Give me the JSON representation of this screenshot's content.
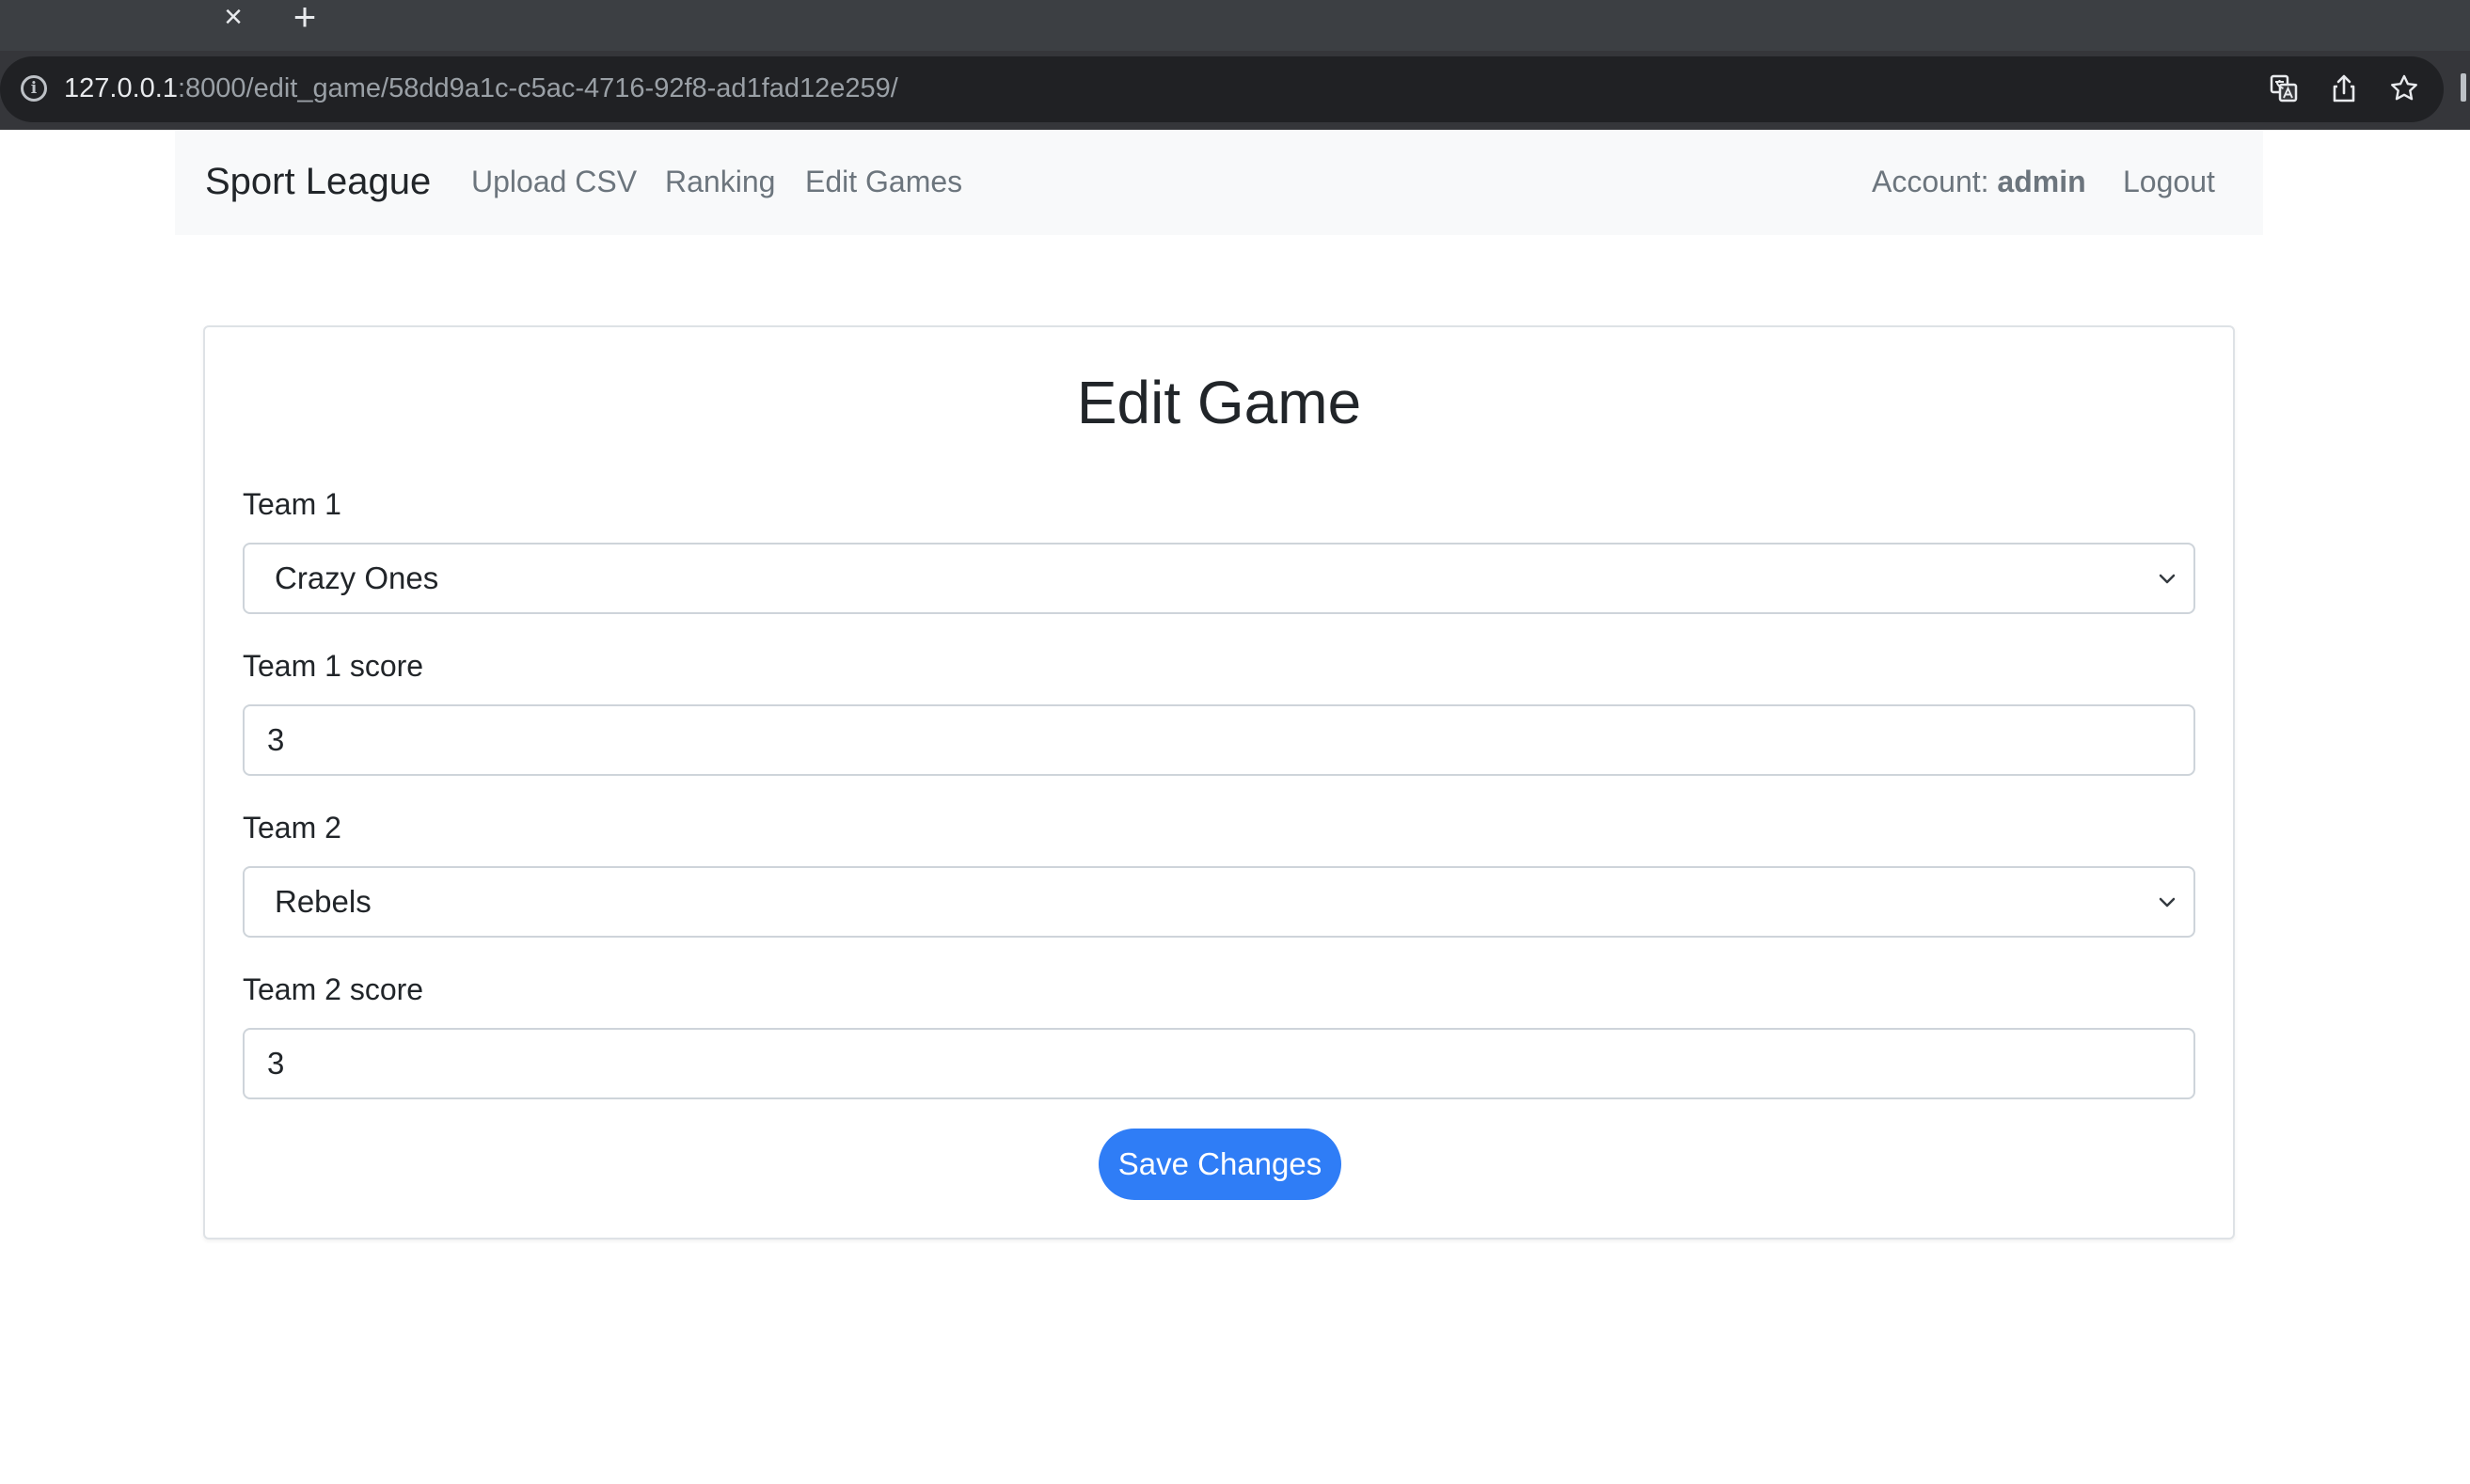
{
  "browser": {
    "url_host": "127.0.0.1",
    "url_path": ":8000/edit_game/58dd9a1c-c5ac-4716-92f8-ad1fad12e259/",
    "close_tab_glyph": "×",
    "new_tab_glyph": "+",
    "info_glyph": "i"
  },
  "navbar": {
    "brand": "Sport League",
    "links": [
      "Upload CSV",
      "Ranking",
      "Edit Games"
    ],
    "account_label": "Account:",
    "account_user": "admin",
    "logout": "Logout"
  },
  "form": {
    "title": "Edit Game",
    "team1_label": "Team 1",
    "team1_value": "Crazy Ones",
    "team1_score_label": "Team 1 score",
    "team1_score_value": "3",
    "team2_label": "Team 2",
    "team2_value": "Rebels",
    "team2_score_label": "Team 2 score",
    "team2_score_value": "3",
    "save_label": "Save Changes"
  },
  "colors": {
    "primary": "#2f7df6",
    "navbar_bg": "#f8f9fa",
    "nav_link": "#6c757d"
  }
}
